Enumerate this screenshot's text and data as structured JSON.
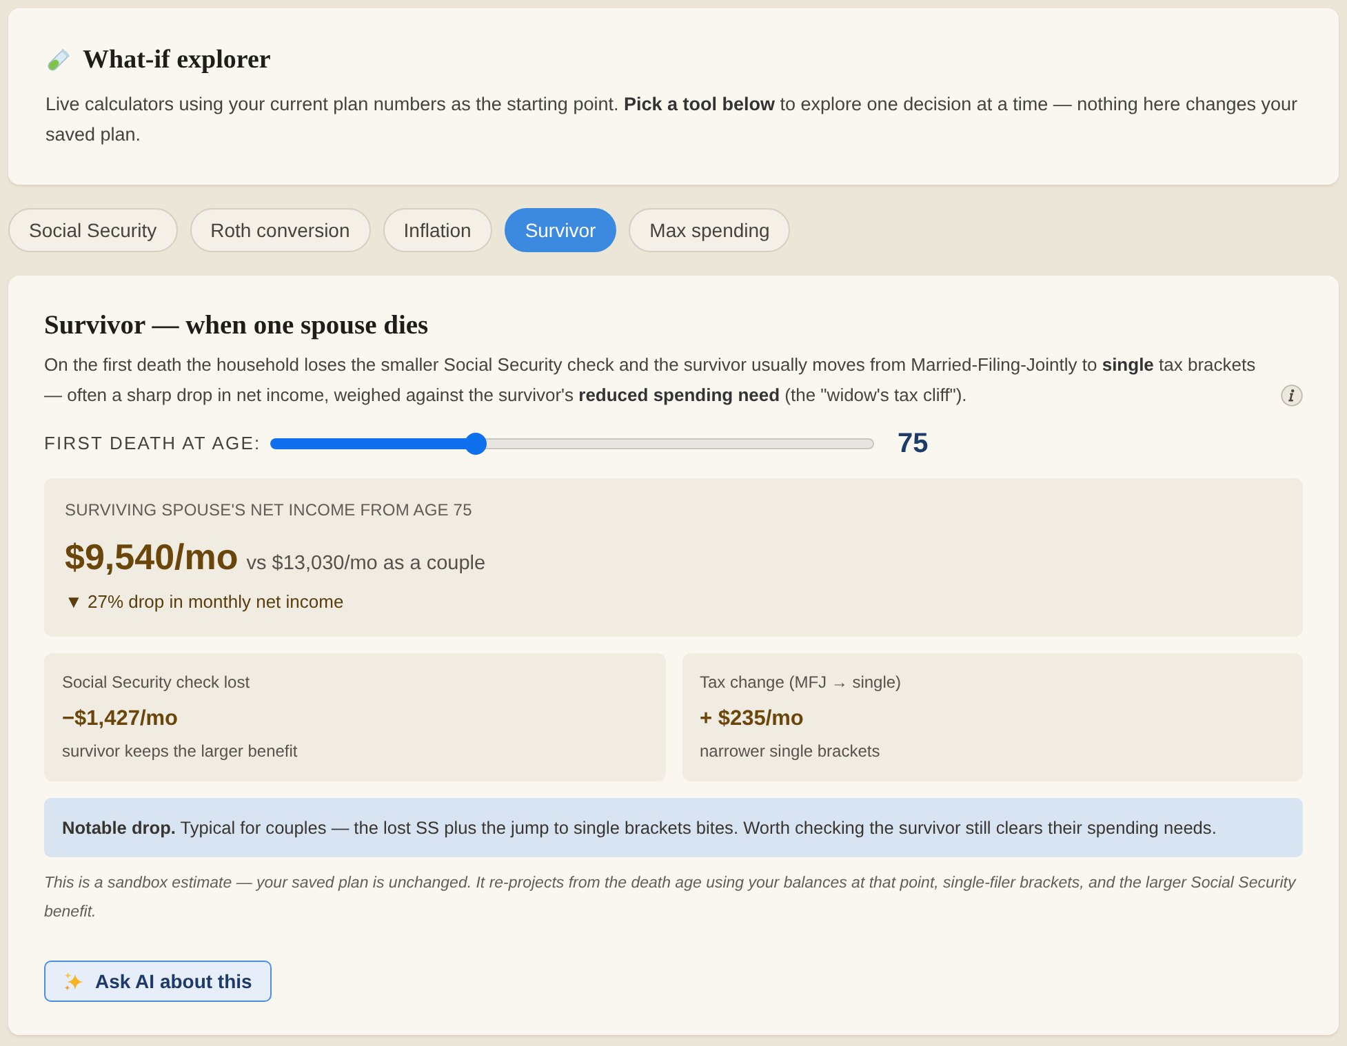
{
  "header": {
    "title": "What-if explorer",
    "description": "Live calculators using your current plan numbers as the starting point. **Pick a tool below** to explore one decision at a time — nothing here changes your saved plan."
  },
  "tabs": [
    {
      "label": "Social Security",
      "selected": false
    },
    {
      "label": "Roth conversion",
      "selected": false
    },
    {
      "label": "Inflation",
      "selected": false
    },
    {
      "label": "Survivor",
      "selected": true
    },
    {
      "label": "Max spending",
      "selected": false
    }
  ],
  "panel": {
    "title": "Survivor — when one spouse dies",
    "description": "On the first death the household loses the smaller Social Security check and the survivor usually moves from Married-Filing-Jointly to **single** tax brackets — often a sharp drop in net income, weighed against the survivor's **reduced spending need** (the \"widow's tax cliff\").",
    "slider": {
      "label": "FIRST DEATH AT AGE:",
      "level": 0.34,
      "value": "75"
    },
    "result": {
      "label": "SURVIVING SPOUSE'S NET INCOME FROM AGE 75",
      "amount": "$9,540/mo",
      "comparison": "vs $13,030/mo as a couple",
      "change": "▼ 27% drop in monthly net income"
    },
    "stats": [
      {
        "label": "Social Security check lost",
        "value": "−$1,427/mo",
        "note": "survivor keeps the larger benefit"
      },
      {
        "label": "Tax change (MFJ → single)",
        "value": "+ $235/mo",
        "note": "narrower single brackets"
      }
    ],
    "callout": "**Notable drop.** Typical for couples — the lost SS plus the jump to single brackets bites. Worth checking the survivor still clears their spending needs.",
    "footnote": "This is a sandbox estimate — your saved plan is unchanged. It re-projects from the death age using your balances at that point, single-filer brackets, and the larger Social Security benefit.",
    "ask_button": {
      "label": "Ask AI about this"
    }
  }
}
